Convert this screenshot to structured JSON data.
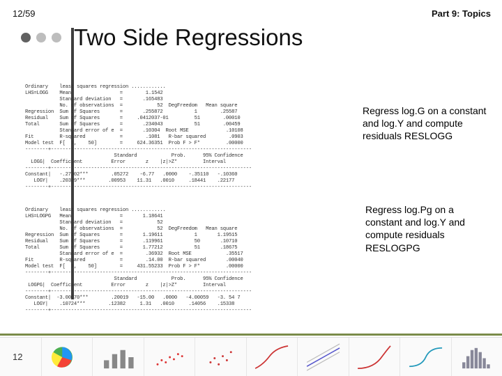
{
  "header": {
    "counter": "12/59",
    "part": "Part 9: Topics"
  },
  "title": "Two Side Regressions",
  "pagenum": "12",
  "captions": {
    "c1": "Regress log.G on a constant and log.Y and compute residuals RESLOGG",
    "c2": "Regress log.Pg on a constant and log.Y and compute residuals RESLOGPG"
  },
  "regression1": {
    "header": "Ordinary    least squares regression ............",
    "lhs": "LHS=LOGG    Mean                 =        1.1542",
    "sd": "            Standard deviation   =       .165483",
    "nobs": "            No. of observations  =            52  DegFreedom   Mean square",
    "reg": "Regression  Sum of Squares       =       .255872           1        .25587",
    "res": "Residual    Sum of Squares       =     .0412037-01         51        .00010",
    "tot": "Total       Sum of Squares       =       .234043           51        .00459",
    "se": "            Standard error of e  =       .10304  Root MSE             .10108",
    "fit": "Fit         R-squared            =        .1081   R-bar squared        .0903",
    "model": "Model test  F[  1,    50]        =     624.36351  Prob F > F*         .00000",
    "tblhdr1": "                               Standard            Prob.      95% Confidence",
    "tblhdr2": "  LOGG|  Coefficient          Error       z    |z|>Z*         Interval",
    "row1": "Constant|   -.27302***        .05272    -6.77   .0000    -.35110   -.10360",
    "row2": "   LOGY|    .20329***        .00953    11.31   .0010     .18441    .22177"
  },
  "regression2": {
    "header": "Ordinary    least squares regression ............",
    "lhs": "LHS=LOGPG   Mean                 =       1.18641",
    "sd": "            Standard deviation   =            52",
    "nobs": "            No. of observations  =            52  DegFreedom   Mean square",
    "reg": "Regression  Sum of Squares       =       1.19611           1       1.19515",
    "res": "Residual    Sum of Squares       =       .119961           50       .10710",
    "tot": "Total       Sum of Squares       =       1.77212           51       .18675",
    "se": "            Standard error of e  =        .36932  Root MSE            .35517",
    "fit": "Fit         R-squared            =        .14.00  R-bar squared       .00040",
    "model": "Model test  F[  1,    50]        =     431.55233  Prob F > F*         .00000",
    "tblhdr1": "                               Standard            Prob.      95% Confidence",
    "tblhdr2": " LOGPG|  Coefficient          Error       z    |z|>Z*         Interval",
    "row1": "Constant|  -3.00070***        .20019   -15.00   .0000   -4.00059   -3. 54 7",
    "row2": "   LOGY|    .10724***        .12382     1.31   .0010     .14056    .15338"
  }
}
